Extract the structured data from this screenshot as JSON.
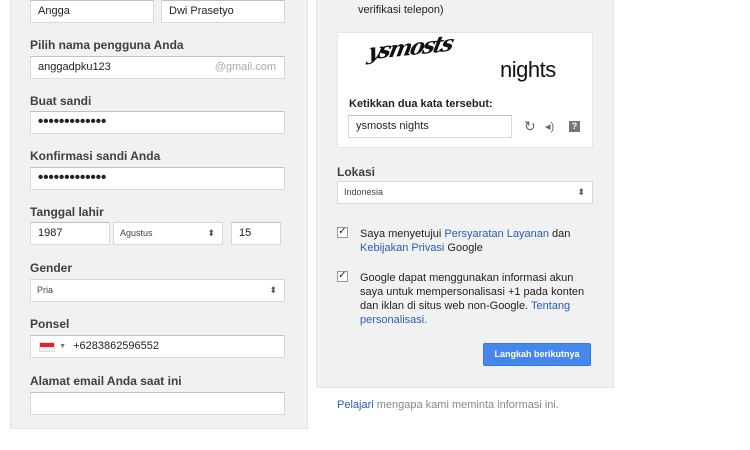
{
  "name": {
    "first": "Angga",
    "last": "Dwi Prasetyo"
  },
  "username": {
    "label": "Pilih nama pengguna Anda",
    "value": "anggadpku123",
    "suffix": "@gmail.com"
  },
  "password": {
    "label": "Buat sandi",
    "value": "•••••••••••••"
  },
  "confirm_password": {
    "label": "Konfirmasi sandi Anda",
    "value": "•••••••••••••"
  },
  "birthday": {
    "label": "Tanggal lahir",
    "year": "1987",
    "month": "Agustus",
    "day": "15"
  },
  "gender": {
    "label": "Gender",
    "value": "Pria"
  },
  "phone": {
    "label": "Ponsel",
    "value": "+6283862596552"
  },
  "current_email": {
    "label": "Alamat email Anda saat ini",
    "value": ""
  },
  "verify_note": "verifikasi telepon)",
  "captcha": {
    "word1": "ysmosts",
    "word2": "nights",
    "prompt": "Ketikkan dua kata tersebut:",
    "value": "ysmosts nights"
  },
  "location": {
    "label": "Lokasi",
    "value": "Indonesia"
  },
  "terms": {
    "prefix": "Saya menyetujui ",
    "tos": "Persyaratan Layanan",
    "and": " dan",
    "privacy": "Kebijakan Privasi",
    "suffix": " Google"
  },
  "personalization": {
    "text": "Google dapat menggunakan informasi akun saya untuk mempersonalisasi +1 pada konten dan iklan di situs web non-Google.",
    "link": "Tentang personalisasi."
  },
  "next_button": "Langkah berikutnya",
  "footer": {
    "link": "Pelajari",
    "text": " mengapa kami meminta informasi ini."
  },
  "colors": {
    "link": "#2a5db0",
    "button": "#4787ed",
    "panel": "#f1f1f1"
  }
}
